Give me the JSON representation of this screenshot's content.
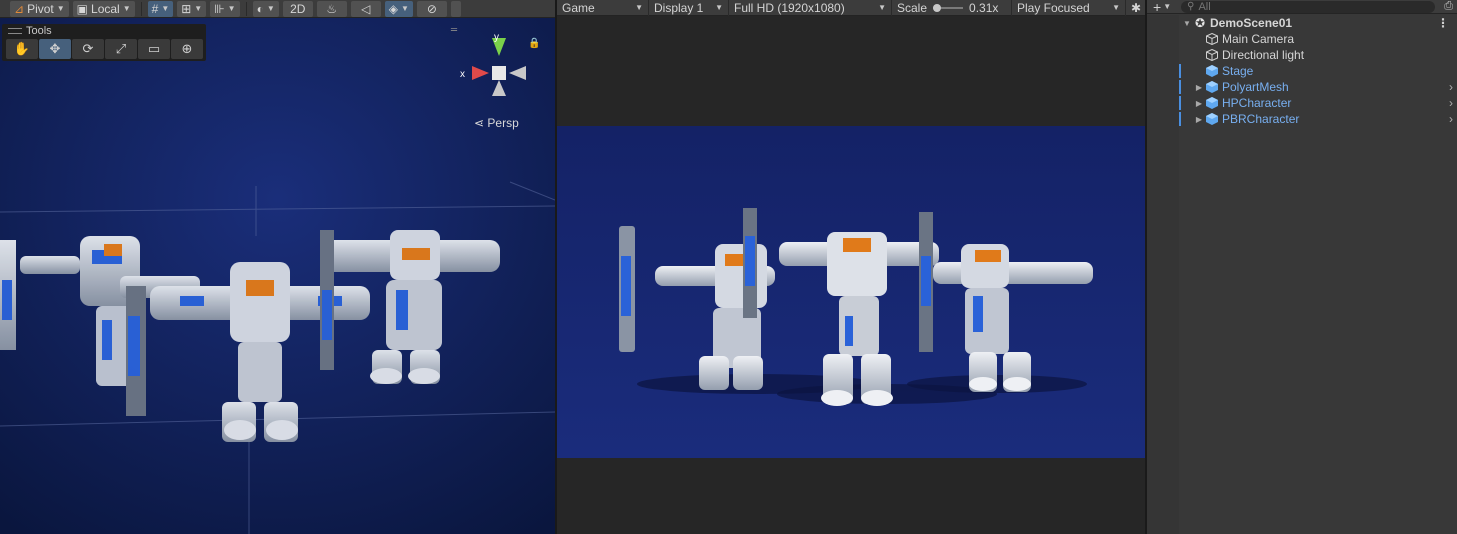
{
  "scene_toolbar": {
    "pivot_label": "Pivot",
    "local_label": "Local",
    "twod_label": "2D"
  },
  "tools_overlay": {
    "title": "Tools",
    "tools": [
      {
        "name": "hand-tool",
        "icon": "hand-icon"
      },
      {
        "name": "move-tool",
        "icon": "move-icon"
      },
      {
        "name": "rotate-tool",
        "icon": "rotate-icon"
      },
      {
        "name": "scale-tool",
        "icon": "scale-icon"
      },
      {
        "name": "rect-tool",
        "icon": "rect-icon"
      },
      {
        "name": "transform-tool",
        "icon": "transform-icon"
      }
    ]
  },
  "scene_gizmo": {
    "x_label": "x",
    "y_label": "y",
    "projection_label": "Persp"
  },
  "game_toolbar": {
    "view_label": "Game",
    "display_label": "Display 1",
    "resolution_label": "Full HD (1920x1080)",
    "scale_label": "Scale",
    "scale_value": "0.31x",
    "play_mode_label": "Play Focused"
  },
  "hierarchy": {
    "search_placeholder": "All",
    "scene_name": "DemoScene01",
    "items": [
      {
        "label": "Main Camera",
        "prefab": false,
        "expandable": false
      },
      {
        "label": "Directional light",
        "prefab": false,
        "expandable": false
      },
      {
        "label": "Stage",
        "prefab": true,
        "expandable": false
      },
      {
        "label": "PolyartMesh",
        "prefab": true,
        "expandable": true
      },
      {
        "label": "HPCharacter",
        "prefab": true,
        "expandable": true
      },
      {
        "label": "PBRCharacter",
        "prefab": true,
        "expandable": true
      }
    ]
  },
  "colors": {
    "scene_bg": "#0c1a4a",
    "game_stage_bg": "#142266",
    "accent_blue": "#4a8fe0",
    "prefab_label": "#78aff0",
    "gizmo_x": "#e04a4a",
    "gizmo_y": "#7ad14a",
    "gizmo_z": "#4a7ae0"
  }
}
